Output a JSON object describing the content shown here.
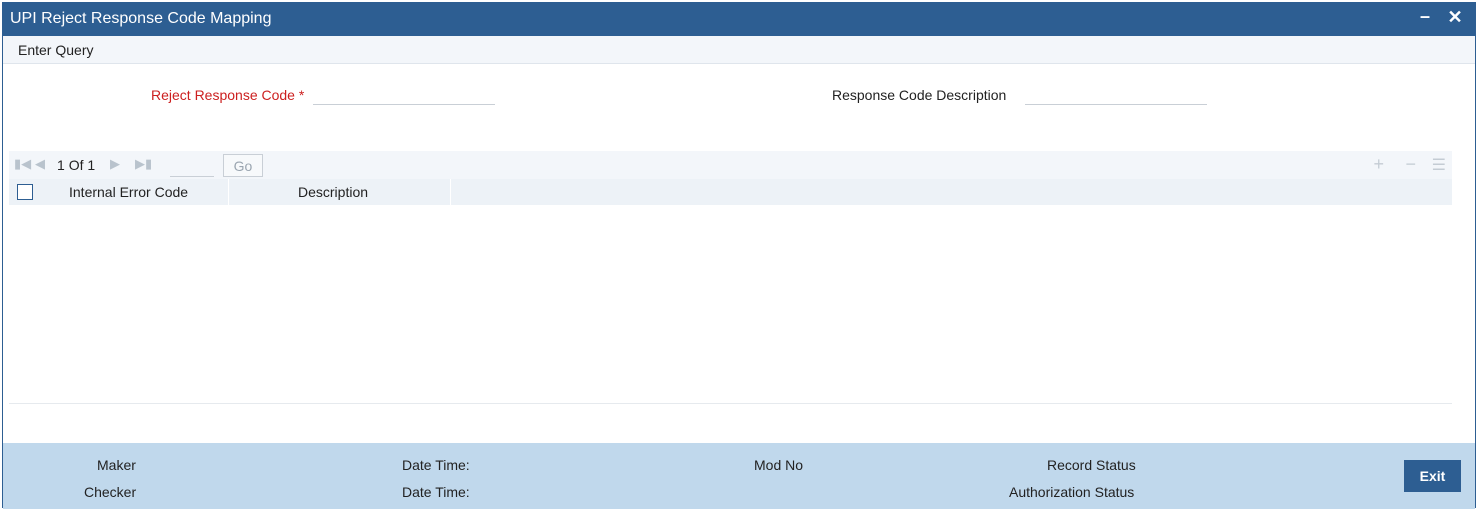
{
  "window": {
    "title": "UPI Reject Response Code Mapping",
    "minimize_glyph": "–",
    "close_glyph": "✕"
  },
  "menu": {
    "enter_query": "Enter Query"
  },
  "form": {
    "reject_code_label": "Reject Response Code",
    "required_marker": "*",
    "reject_code_value": "",
    "response_desc_label": "Response Code Description",
    "response_desc_value": ""
  },
  "grid": {
    "pager": {
      "current": "1",
      "of_label": "Of",
      "total": "1",
      "page_input": "",
      "go_label": "Go"
    },
    "columns": [
      "Internal Error Code",
      "Description"
    ],
    "rows": [],
    "icons": {
      "first": "first-page-icon",
      "prev": "prev-page-icon",
      "next": "next-page-icon",
      "last": "last-page-icon",
      "add": "add-row-icon",
      "delete": "delete-row-icon",
      "list": "list-view-icon"
    }
  },
  "footer": {
    "maker_label": "Maker",
    "checker_label": "Checker",
    "date_time_label_1": "Date Time:",
    "date_time_label_2": "Date Time:",
    "mod_no_label": "Mod No",
    "record_status_label": "Record Status",
    "auth_status_label": "Authorization Status",
    "exit_label": "Exit"
  },
  "colors": {
    "titlebar": "#2d5e92",
    "required_label": "#cc1f1f",
    "footer": "#c0d8ec",
    "exit_button": "#2d5e92"
  }
}
